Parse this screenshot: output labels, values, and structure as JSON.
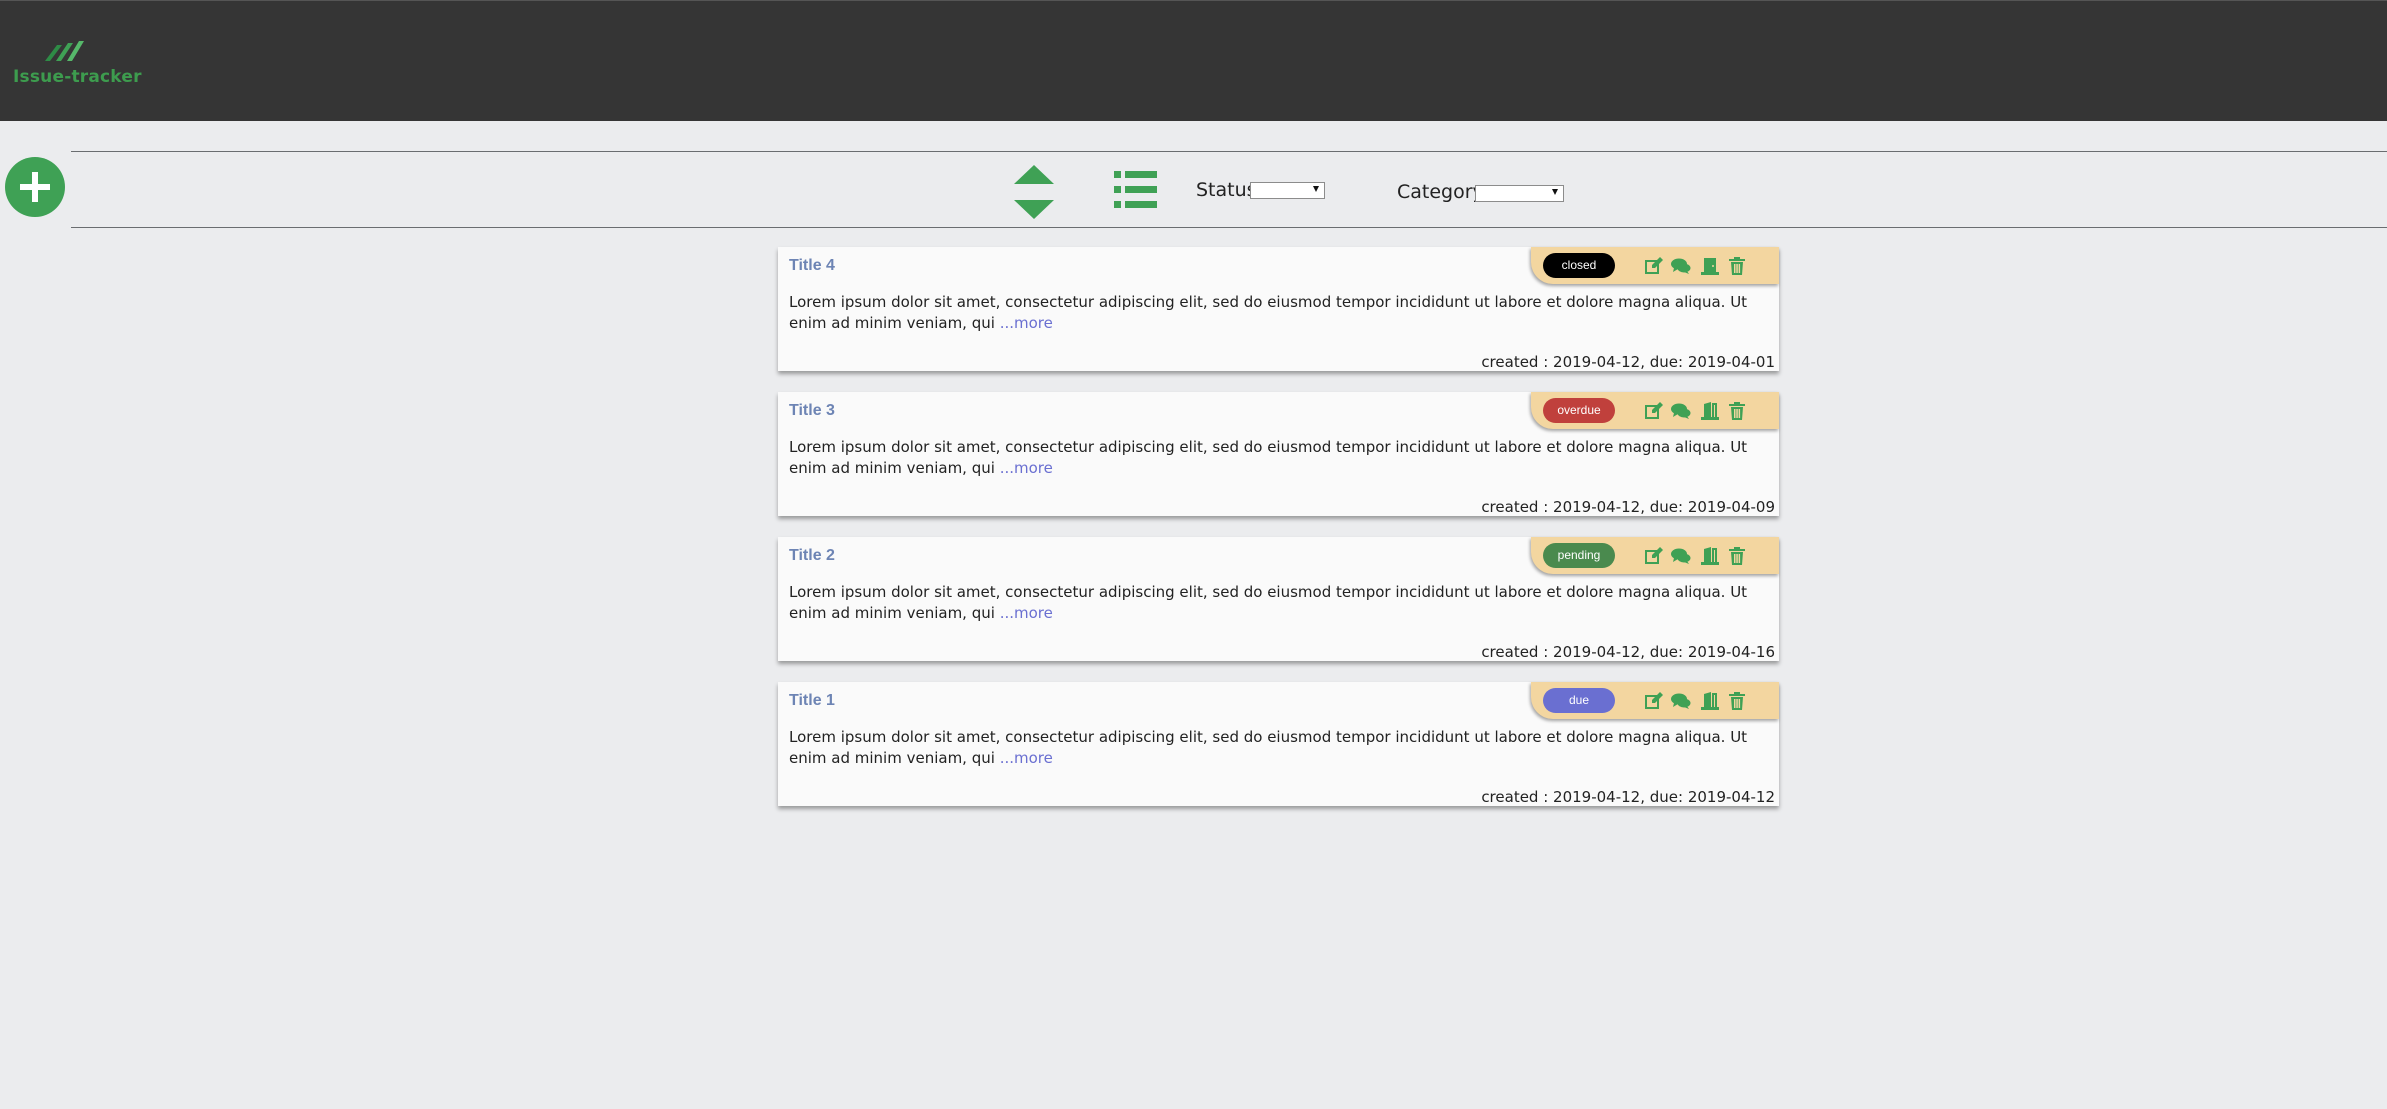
{
  "app": {
    "name": "Issue-tracker"
  },
  "toolbar": {
    "add_icon": "plus-icon",
    "sort_icon": "sort-icon",
    "list_icon": "list-icon",
    "status_label": "Status",
    "status_value": "",
    "category_label": "Category",
    "category_value": ""
  },
  "colors": {
    "accent": "#3fa155",
    "header": "#353535",
    "card_toolbar": "#f3d6a0",
    "status_closed": "#000000",
    "status_overdue": "#c0403c",
    "status_pending": "#4a8a4e",
    "status_due": "#6a6fd1"
  },
  "issues": [
    {
      "title": "Title 4",
      "status": "closed",
      "status_color": "#000000",
      "description": "Lorem ipsum dolor sit amet, consectetur adipiscing elit, sed do eiusmod tempor incididunt ut labore et dolore magna aliqua. Ut enim ad minim veniam, qui",
      "more": "...more",
      "dates": "created : 2019-04-12, due: 2019-04-01",
      "move_icon": "door-closed-icon"
    },
    {
      "title": "Title 3",
      "status": "overdue",
      "status_color": "#c0403c",
      "description": "Lorem ipsum dolor sit amet, consectetur adipiscing elit, sed do eiusmod tempor incididunt ut labore et dolore magna aliqua. Ut enim ad minim veniam, qui",
      "more": "...more",
      "dates": "created : 2019-04-12, due: 2019-04-09",
      "move_icon": "door-open-icon"
    },
    {
      "title": "Title 2",
      "status": "pending",
      "status_color": "#4a8a4e",
      "description": "Lorem ipsum dolor sit amet, consectetur adipiscing elit, sed do eiusmod tempor incididunt ut labore et dolore magna aliqua. Ut enim ad minim veniam, qui",
      "more": "...more",
      "dates": "created : 2019-04-12, due: 2019-04-16",
      "move_icon": "door-open-icon"
    },
    {
      "title": "Title 1",
      "status": "due",
      "status_color": "#6a6fd1",
      "description": "Lorem ipsum dolor sit amet, consectetur adipiscing elit, sed do eiusmod tempor incididunt ut labore et dolore magna aliqua. Ut enim ad minim veniam, qui",
      "more": "...more",
      "dates": "created : 2019-04-12, due: 2019-04-12",
      "move_icon": "door-open-icon"
    }
  ]
}
